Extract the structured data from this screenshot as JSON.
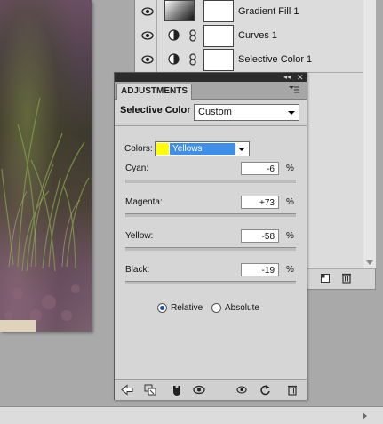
{
  "layers": [
    {
      "name": "Gradient Fill 1",
      "type": "gradient"
    },
    {
      "name": "Curves 1",
      "type": "curves"
    },
    {
      "name": "Selective Color 1",
      "type": "selective-color"
    }
  ],
  "adjustments": {
    "tab_label": "ADJUSTMENTS",
    "title": "Selective Color",
    "preset": "Custom",
    "colors_label": "Colors:",
    "colors_value": "Yellows",
    "colors_swatch": "#ffff00",
    "sliders": [
      {
        "label": "Cyan:",
        "value": "-6",
        "unit": "%",
        "level": -6
      },
      {
        "label": "Magenta:",
        "value": "+73",
        "unit": "%",
        "level": 73
      },
      {
        "label": "Yellow:",
        "value": "-58",
        "unit": "%",
        "level": -58
      },
      {
        "label": "Black:",
        "value": "-19",
        "unit": "%",
        "level": -19
      }
    ],
    "method_options": [
      "Relative",
      "Absolute"
    ],
    "method_selected": "Relative"
  }
}
